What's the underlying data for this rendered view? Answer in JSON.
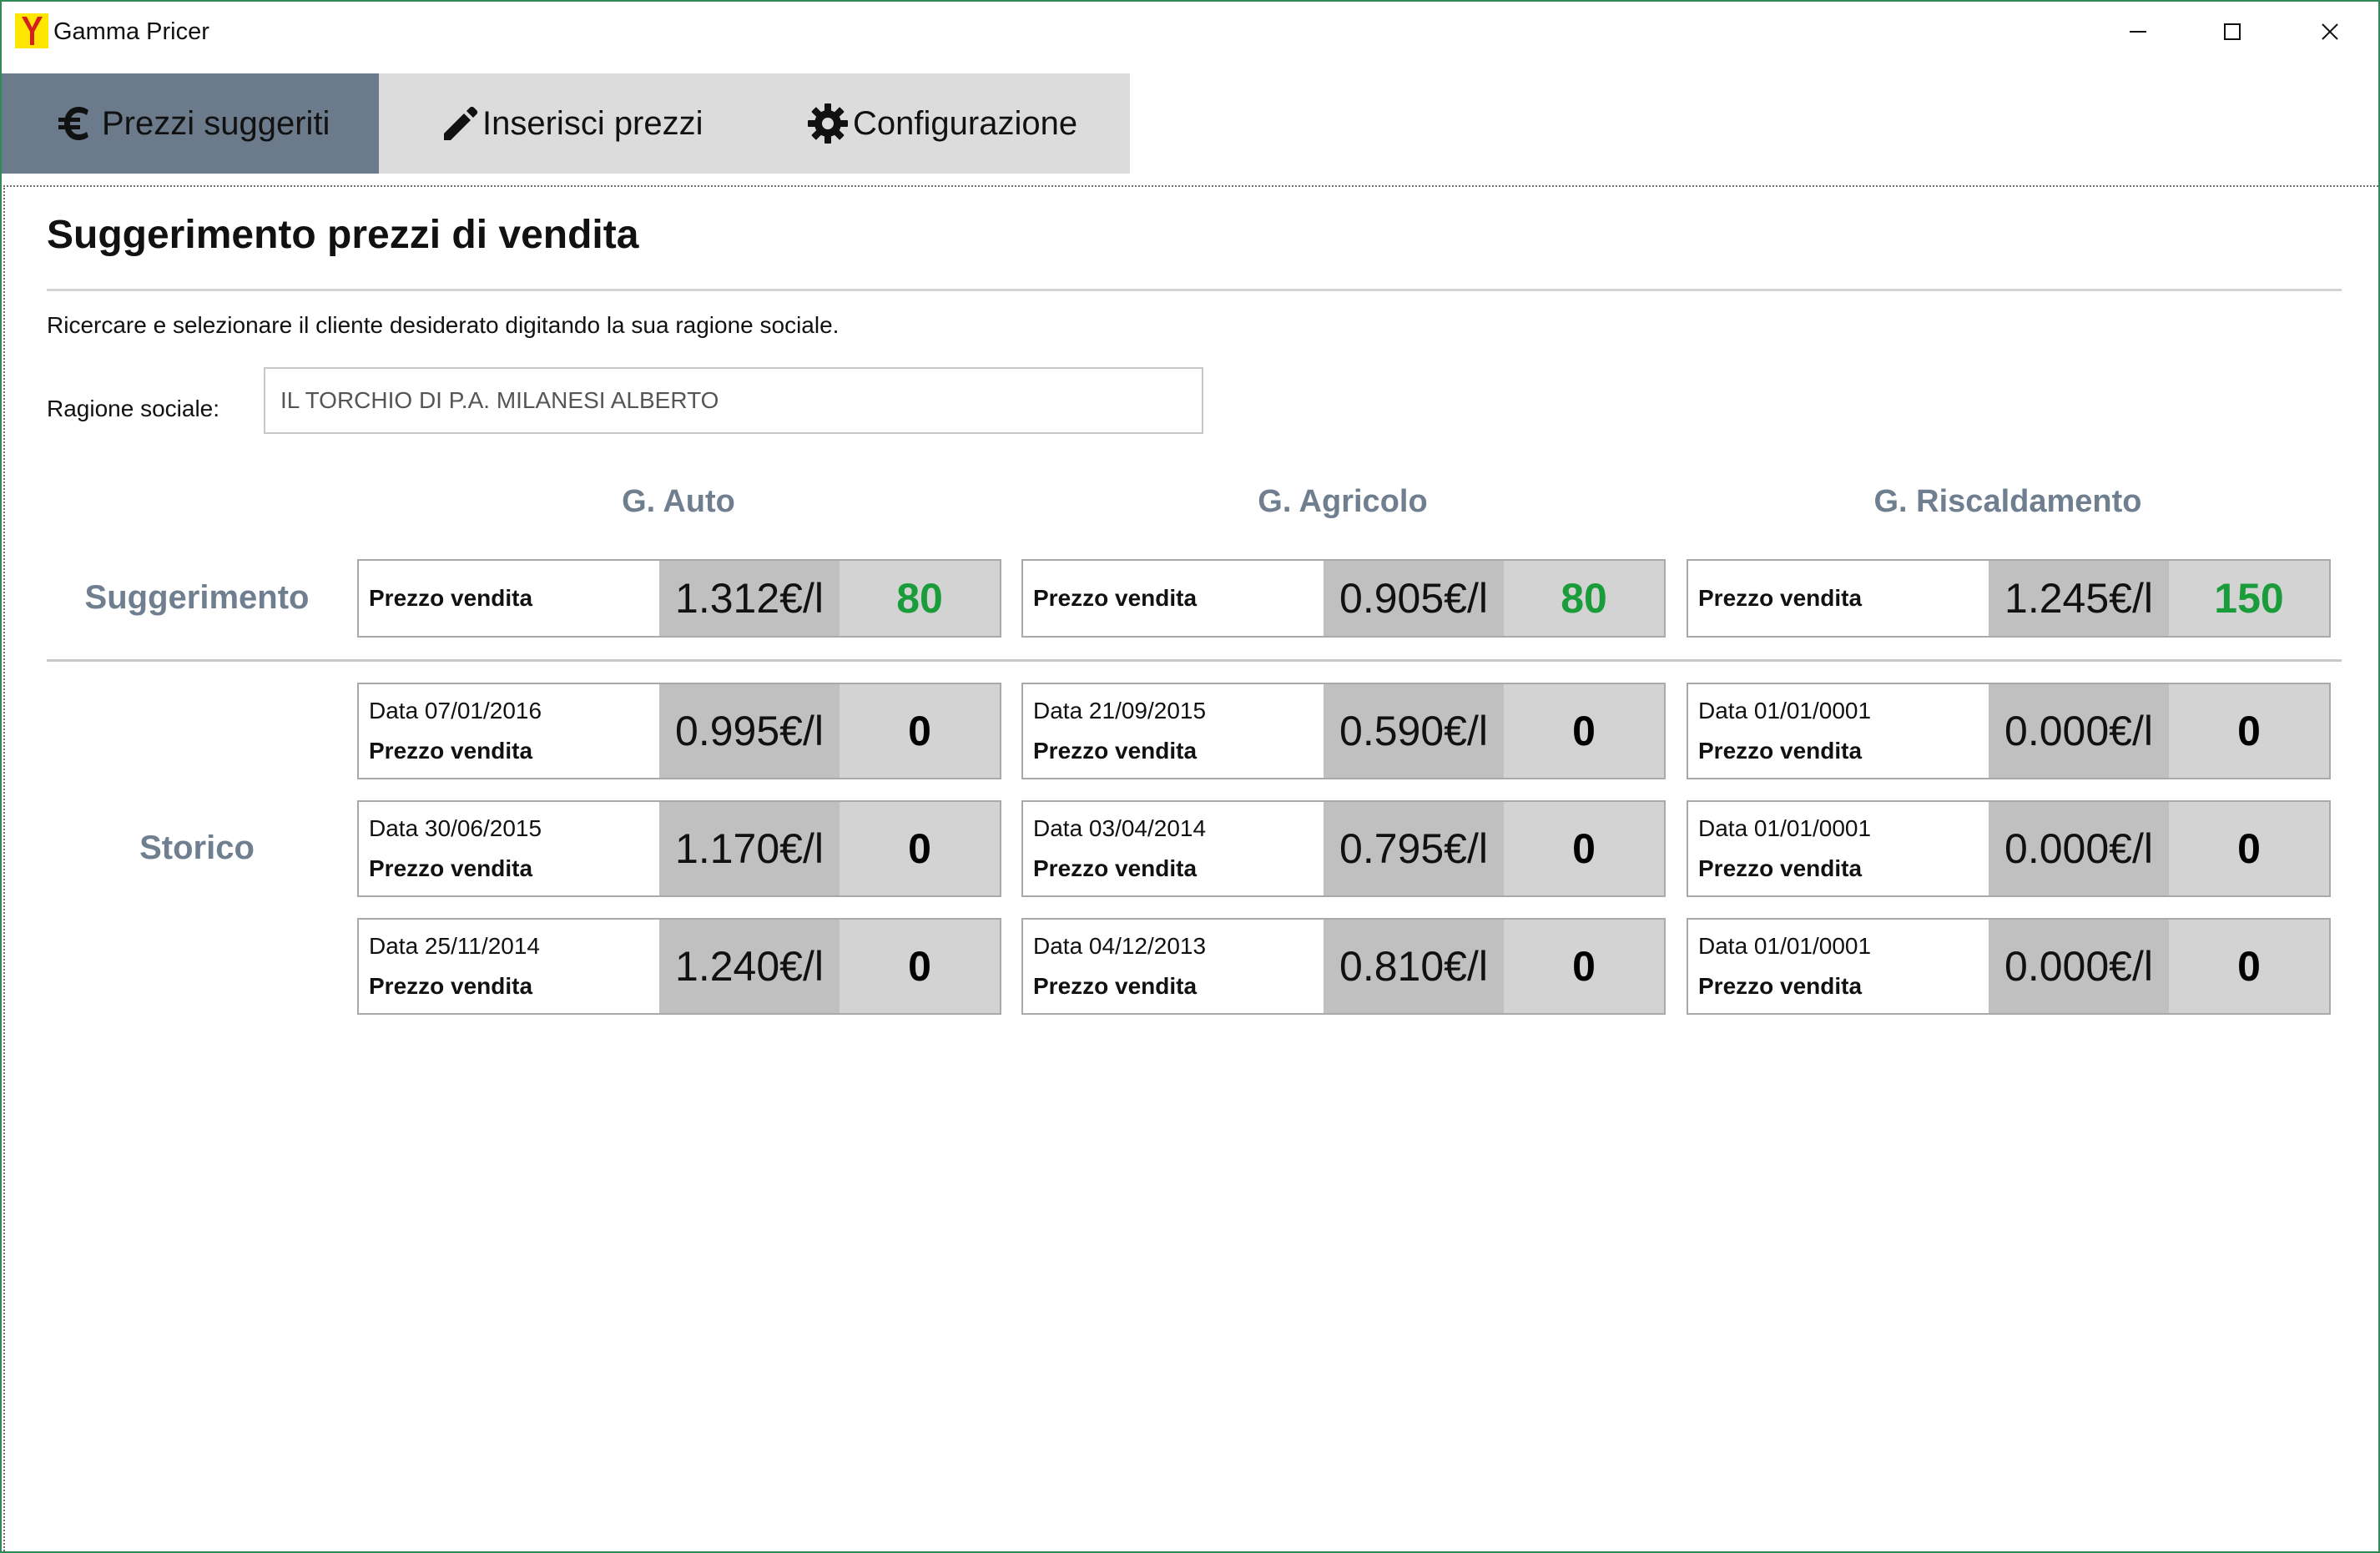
{
  "window": {
    "title": "Gamma Pricer",
    "accent": "#2e8b57"
  },
  "tabs": [
    {
      "label": "Prezzi suggeriti",
      "icon": "euro-icon",
      "active": true
    },
    {
      "label": "Inserisci prezzi",
      "icon": "pencil-icon",
      "active": false
    },
    {
      "label": "Configurazione",
      "icon": "gear-icon",
      "active": false
    }
  ],
  "page": {
    "title": "Suggerimento prezzi di vendita",
    "instruction": "Ricercare e selezionare il cliente desiderato digitando la sua ragione sociale.",
    "field_label": "Ragione sociale:",
    "field_value": "IL TORCHIO DI P.A. MILANESI ALBERTO"
  },
  "columns": [
    "G. Auto",
    "G. Agricolo",
    "G. Riscaldamento"
  ],
  "rows": {
    "suggestion_label": "Suggerimento",
    "history_label": "Storico"
  },
  "suggestions": [
    {
      "label": "Prezzo vendita",
      "price": "1.312€/l",
      "qty": "80"
    },
    {
      "label": "Prezzo vendita",
      "price": "0.905€/l",
      "qty": "80"
    },
    {
      "label": "Prezzo vendita",
      "price": "1.245€/l",
      "qty": "150"
    }
  ],
  "history": [
    [
      {
        "date": "Data 07/01/2016",
        "label": "Prezzo vendita",
        "price": "0.995€/l",
        "qty": "0"
      },
      {
        "date": "Data 21/09/2015",
        "label": "Prezzo vendita",
        "price": "0.590€/l",
        "qty": "0"
      },
      {
        "date": "Data 01/01/0001",
        "label": "Prezzo vendita",
        "price": "0.000€/l",
        "qty": "0"
      }
    ],
    [
      {
        "date": "Data 30/06/2015",
        "label": "Prezzo vendita",
        "price": "1.170€/l",
        "qty": "0"
      },
      {
        "date": "Data 03/04/2014",
        "label": "Prezzo vendita",
        "price": "0.795€/l",
        "qty": "0"
      },
      {
        "date": "Data 01/01/0001",
        "label": "Prezzo vendita",
        "price": "0.000€/l",
        "qty": "0"
      }
    ],
    [
      {
        "date": "Data 25/11/2014",
        "label": "Prezzo vendita",
        "price": "1.240€/l",
        "qty": "0"
      },
      {
        "date": "Data 04/12/2013",
        "label": "Prezzo vendita",
        "price": "0.810€/l",
        "qty": "0"
      },
      {
        "date": "Data 01/01/0001",
        "label": "Prezzo vendita",
        "price": "0.000€/l",
        "qty": "0"
      }
    ]
  ],
  "colors": {
    "tab_active": "#6c7b8b",
    "tab_bg": "#dcdcdc",
    "header_text": "#6f7f8f",
    "suggest_qty": "#1a9c3a"
  }
}
